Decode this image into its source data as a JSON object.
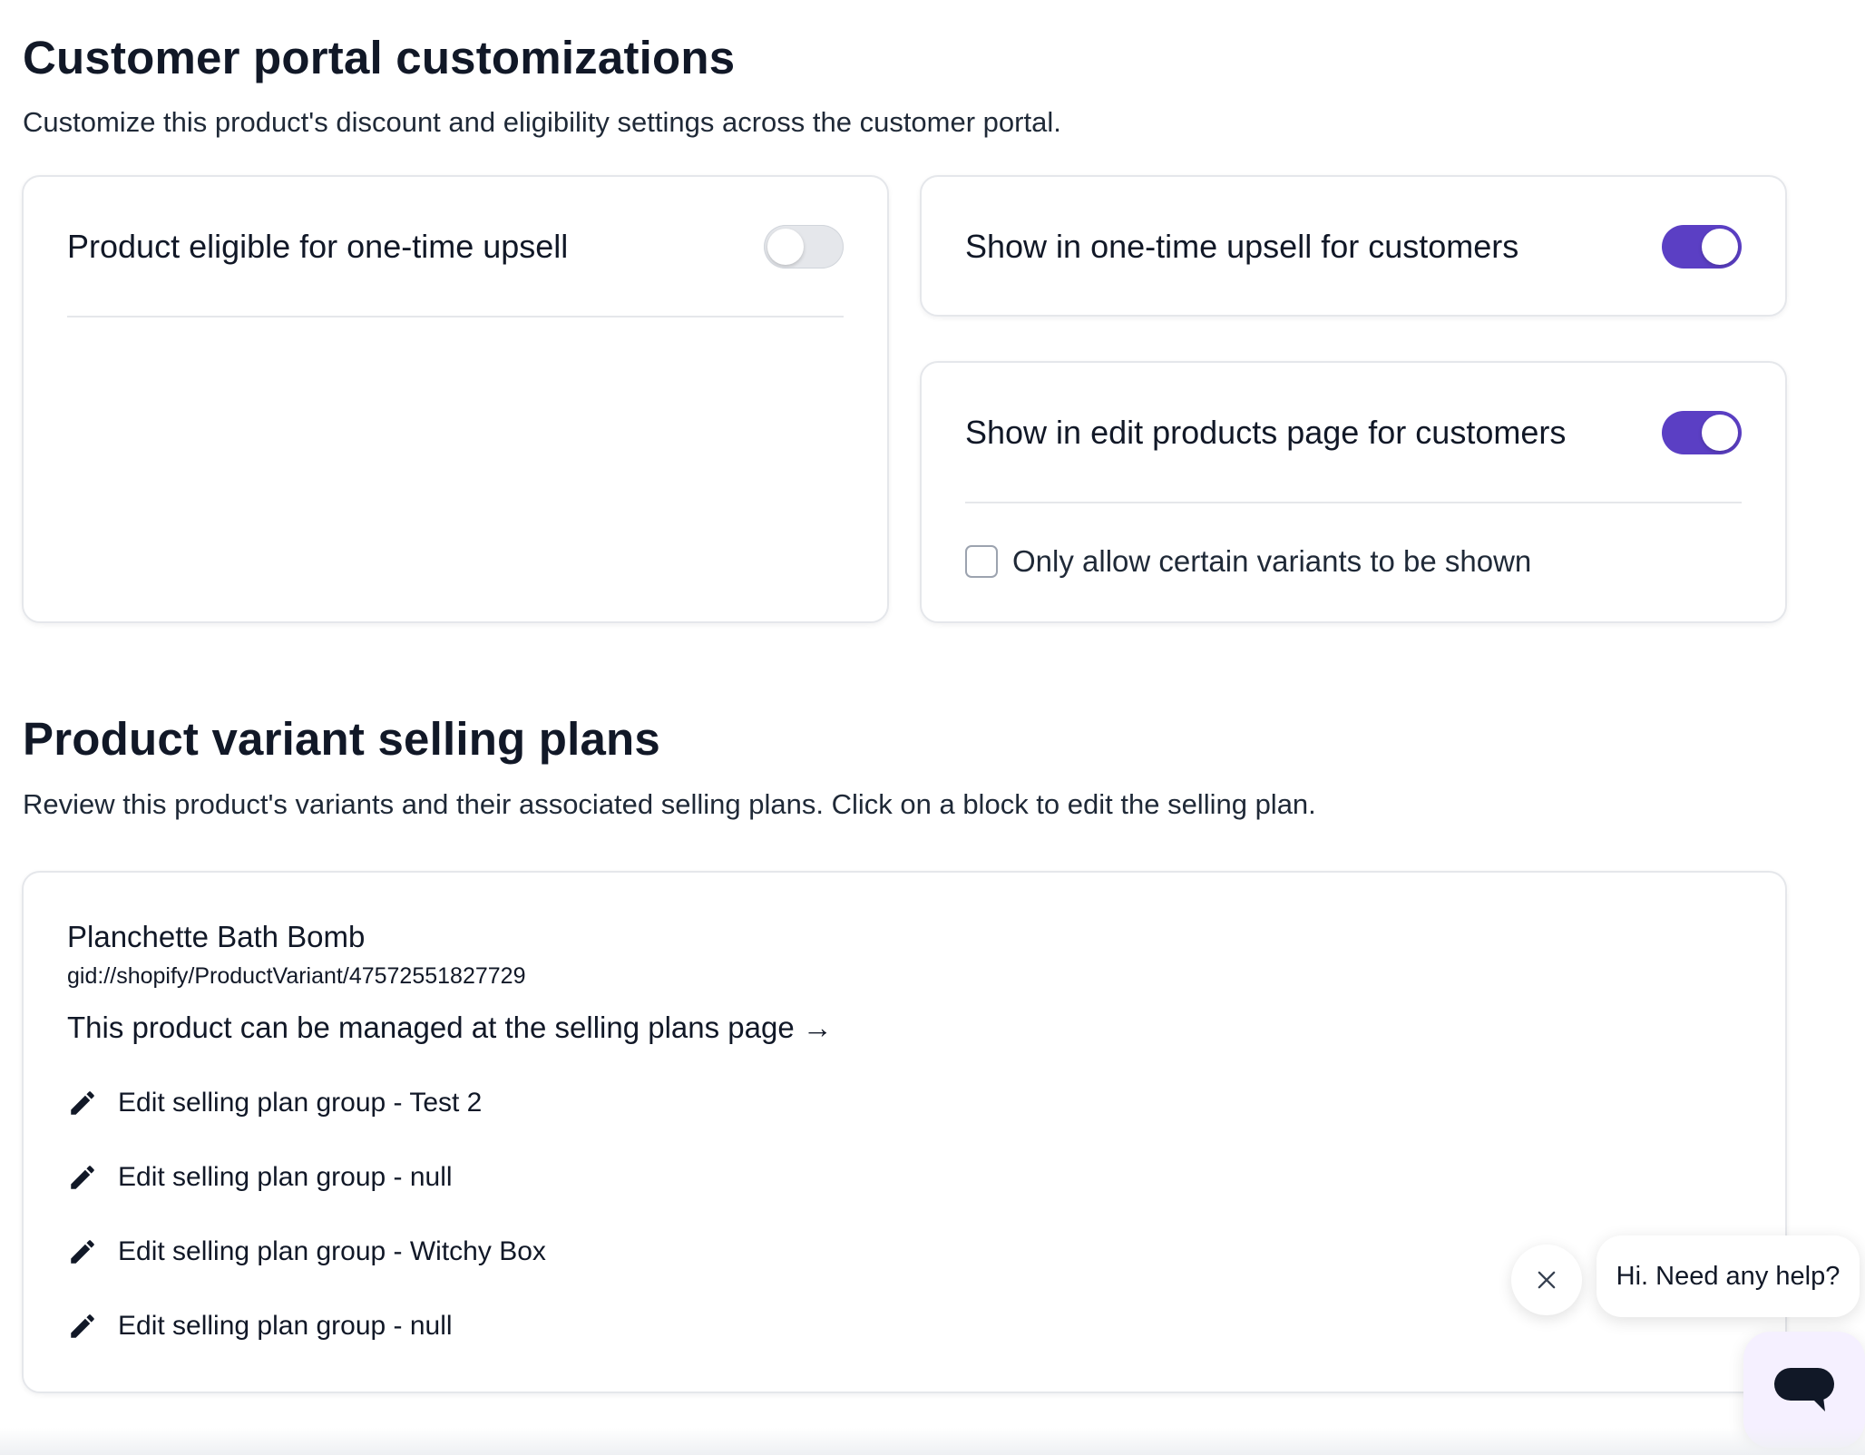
{
  "customizations": {
    "title": "Customer portal customizations",
    "description": "Customize this product's discount and eligibility settings across the customer portal.",
    "eligible_upsell": {
      "label": "Product eligible for one-time upsell",
      "enabled": false
    },
    "show_upsell": {
      "label": "Show in one-time upsell for customers",
      "enabled": true
    },
    "show_edit_products": {
      "label": "Show in edit products page for customers",
      "enabled": true,
      "checkbox_label": "Only allow certain variants to be shown",
      "checkbox_checked": false
    },
    "toggle_on_color": "#5b3fc4",
    "toggle_off_color": "#e5e7eb"
  },
  "selling_plans": {
    "title": "Product variant selling plans",
    "description": "Review this product's variants and their associated selling plans. Click on a block to edit the selling plan.",
    "variant": {
      "name": "Planchette Bath Bomb",
      "gid": "gid://shopify/ProductVariant/47572551827729",
      "manage_link": "This product can be managed at the selling plans page →",
      "plan_groups": [
        {
          "label": "Edit selling plan group - Test 2",
          "icon": "pencil-icon"
        },
        {
          "label": "Edit selling plan group - null",
          "icon": "pencil-icon"
        },
        {
          "label": "Edit selling plan group - Witchy Box",
          "icon": "pencil-icon"
        },
        {
          "label": "Edit selling plan group - null",
          "icon": "pencil-icon"
        }
      ]
    }
  },
  "chat": {
    "greeting": "Hi. Need any help?",
    "close_icon": "close-icon",
    "launcher_icon": "chat-icon"
  }
}
